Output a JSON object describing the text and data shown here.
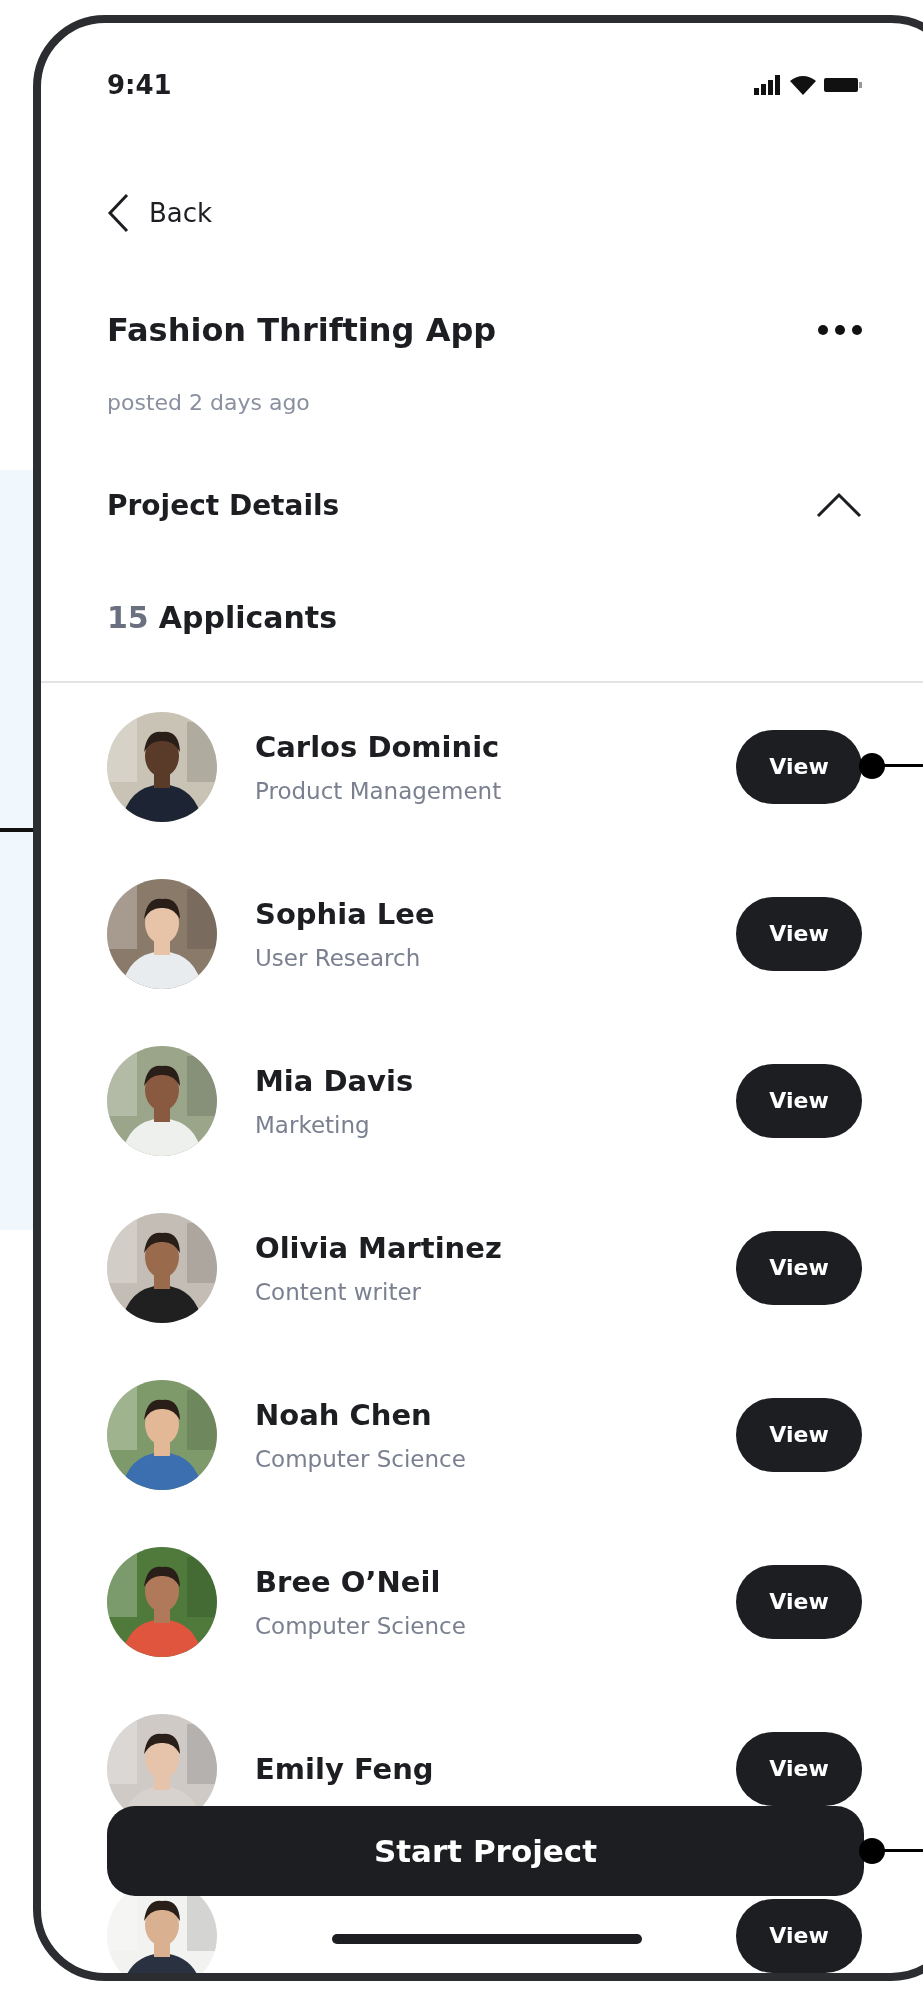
{
  "status_bar": {
    "time": "9:41"
  },
  "nav": {
    "back_label": "Back"
  },
  "project": {
    "title": "Fashion Thrifting App",
    "posted": "posted 2 days ago",
    "details_label": "Project Details",
    "details_expanded": true
  },
  "applicants": {
    "count": "15",
    "label": "Applicants"
  },
  "rows": [
    {
      "name": "Carlos Dominic",
      "role": "Product Management",
      "action": "View",
      "annotated": true
    },
    {
      "name": "Sophia Lee",
      "role": "User Research",
      "action": "View",
      "annotated": false
    },
    {
      "name": "Mia Davis",
      "role": "Marketing",
      "action": "View",
      "annotated": false
    },
    {
      "name": "Olivia Martinez",
      "role": "Content writer",
      "action": "View",
      "annotated": false
    },
    {
      "name": "Noah Chen",
      "role": "Computer Science",
      "action": "View",
      "annotated": false
    },
    {
      "name": "Bree O’Neil",
      "role": "Computer Science",
      "action": "View",
      "annotated": false
    },
    {
      "name": "Emily Feng",
      "action": "View",
      "annotated": false
    },
    {
      "action": "View",
      "annotated": false
    }
  ],
  "primary_action": {
    "label": "Start Project",
    "annotated": true
  }
}
